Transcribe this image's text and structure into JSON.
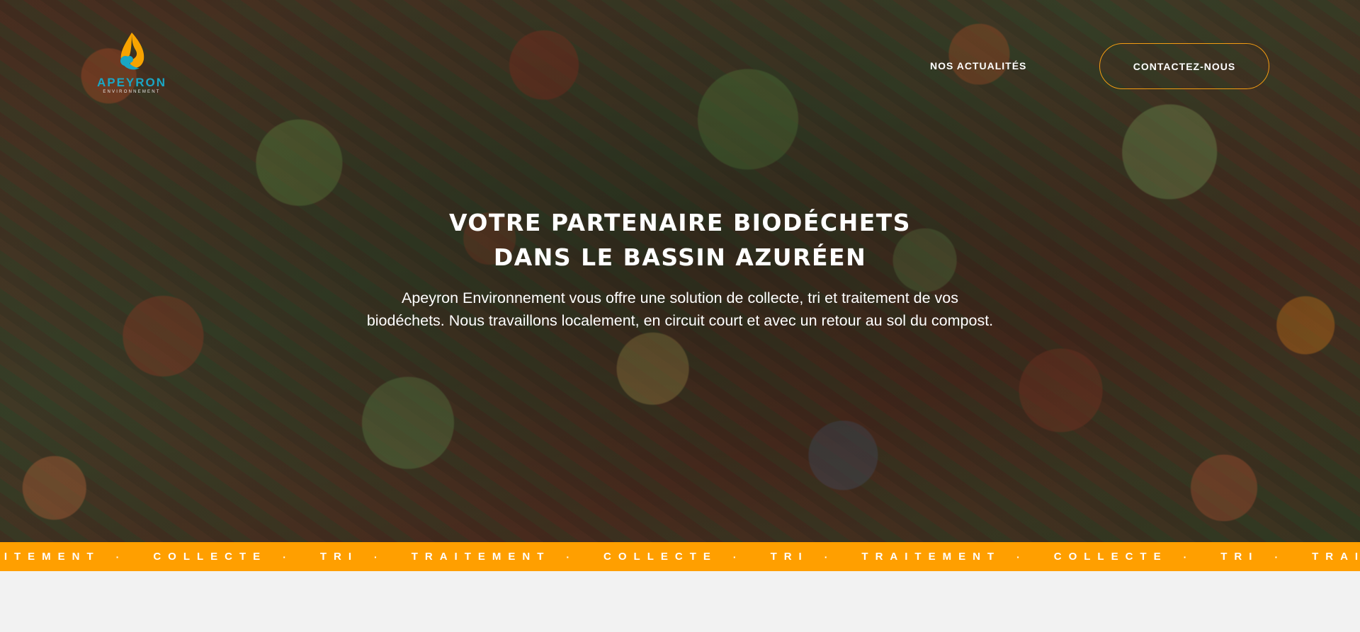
{
  "brand": {
    "name": "APEYRON",
    "tagline": "ENVIRONNEMENT",
    "colors": {
      "primary": "#1aa6c4",
      "accent": "#f39c12"
    }
  },
  "nav": {
    "news_label": "NOS ACTUALITÉS",
    "contact_label": "CONTACTEZ-NOUS"
  },
  "hero": {
    "headline_line1": "VOTRE PARTENAIRE BIODÉCHETS",
    "headline_line2": "DANS LE BASSIN AZURÉEN",
    "subtext_line1": "Apeyron Environnement vous offre une solution de collecte, tri et traitement de vos",
    "subtext_line2": "biodéchets. Nous travaillons localement, en circuit court et avec un retour au sol du compost."
  },
  "ticker": {
    "separator": "·",
    "items": [
      "AITEMENT",
      "COLLECTE",
      "TRI",
      "TRAITEMENT",
      "COLLECTE",
      "TRI",
      "TRAITEMENT",
      "COLLECTE",
      "TRI",
      "TRAIT"
    ]
  }
}
